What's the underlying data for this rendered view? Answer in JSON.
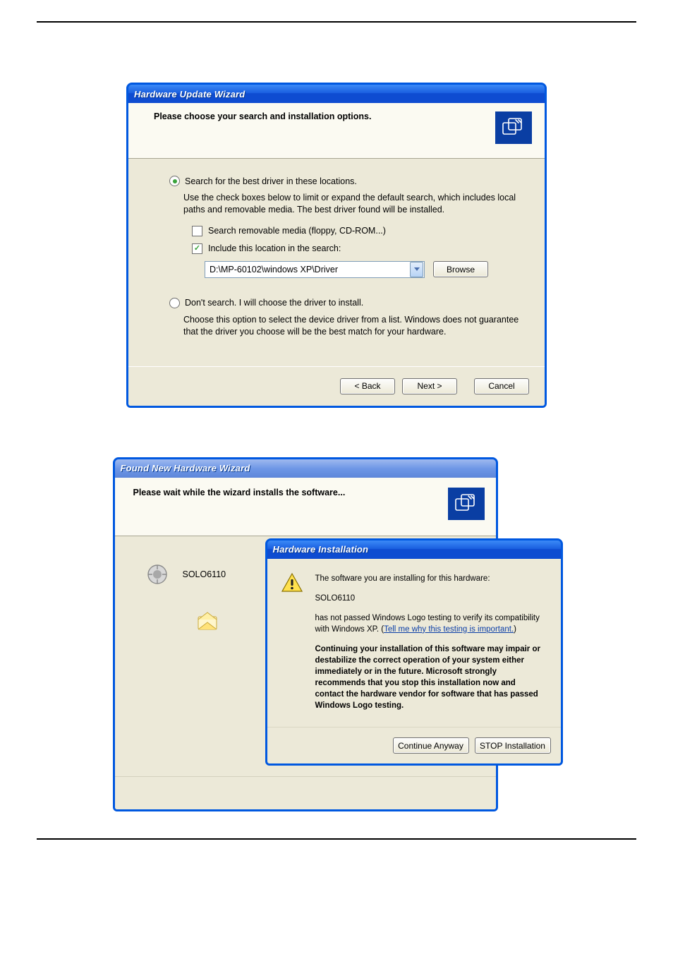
{
  "wizard1": {
    "title": "Hardware Update Wizard",
    "header": "Please choose your search and installation options.",
    "opt_search": {
      "label": "Search for the best driver in these locations.",
      "desc": "Use the check boxes below to limit or expand the default search, which includes local paths and removable media. The best driver found will be installed.",
      "check_removable": "Search removable media (floppy, CD-ROM...)",
      "check_include": "Include this location in the search:",
      "path_value": "D:\\MP-60102\\windows XP\\Driver",
      "browse": "Browse"
    },
    "opt_manual": {
      "label": "Don't search. I will choose the driver to install.",
      "desc": "Choose this option to select the device driver from a list.  Windows does not guarantee that the driver you choose will be the best match for your hardware."
    },
    "buttons": {
      "back": "< Back",
      "next": "Next >",
      "cancel": "Cancel"
    }
  },
  "wizard2": {
    "title": "Found New Hardware Wizard",
    "header": "Please wait while the wizard installs the software...",
    "device_name": "SOLO6110"
  },
  "warn_dialog": {
    "title": "Hardware Installation",
    "line1": "The software you are installing for this hardware:",
    "device": "SOLO6110",
    "line2a": "has not passed Windows Logo testing to verify its compatibility with Windows XP. (",
    "link": "Tell me why this testing is important.",
    "line2b": ")",
    "bold": "Continuing your installation of this software may impair or destabilize the correct operation of your system either immediately or in the future. Microsoft strongly recommends that you stop this installation now and contact the hardware vendor for software that has passed Windows Logo testing.",
    "continue": "Continue Anyway",
    "stop": "STOP Installation"
  }
}
